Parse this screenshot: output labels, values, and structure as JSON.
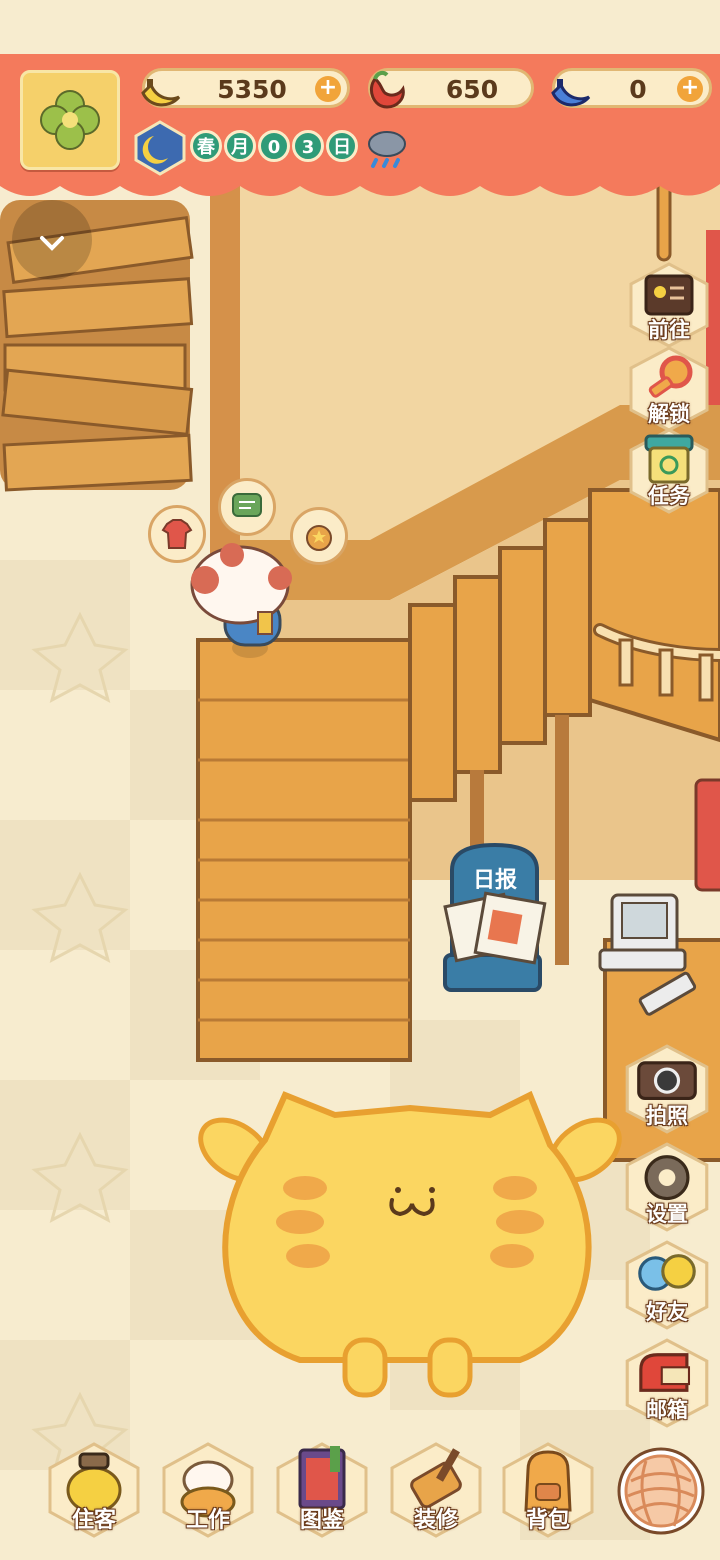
{
  "status_bar": {},
  "resources": {
    "banana": {
      "value": "5350",
      "icon": "banana-icon",
      "has_plus": true
    },
    "chili": {
      "value": "650",
      "icon": "chili-pepper-icon",
      "has_plus": false
    },
    "blue_banana": {
      "value": "0",
      "icon": "blue-banana-icon",
      "has_plus": true
    }
  },
  "date": {
    "season": "春",
    "month": "月",
    "day_digits": [
      "0",
      "3"
    ],
    "day": "日",
    "weather_icon": "rain-cloud-icon"
  },
  "scene": {
    "newspaper_sign": "日报"
  },
  "side_menu": [
    {
      "id": "goto",
      "label": "前往",
      "icon": "notice-board-icon"
    },
    {
      "id": "unlock",
      "label": "解锁",
      "icon": "key-icon"
    },
    {
      "id": "tasks",
      "label": "任务",
      "icon": "task-clipboard-icon"
    },
    {
      "id": "photo",
      "label": "拍照",
      "icon": "camera-icon"
    },
    {
      "id": "settings",
      "label": "设置",
      "icon": "gear-icon"
    },
    {
      "id": "friends",
      "label": "好友",
      "icon": "friends-icon"
    },
    {
      "id": "mail",
      "label": "邮箱",
      "icon": "mailbox-icon"
    }
  ],
  "bottom_menu": [
    {
      "id": "residents",
      "label": "住客"
    },
    {
      "id": "work",
      "label": "工作"
    },
    {
      "id": "collection",
      "label": "图鉴"
    },
    {
      "id": "decorate",
      "label": "装修"
    },
    {
      "id": "backpack",
      "label": "背包"
    }
  ],
  "colors": {
    "hud": "#f47a5c",
    "pill": "#fbecc8",
    "wood": "#e8a449",
    "wall": "#f2d6a2",
    "floor_light": "#f7eccf",
    "floor_dark": "#efe0bd",
    "cat": "#fbd661"
  }
}
